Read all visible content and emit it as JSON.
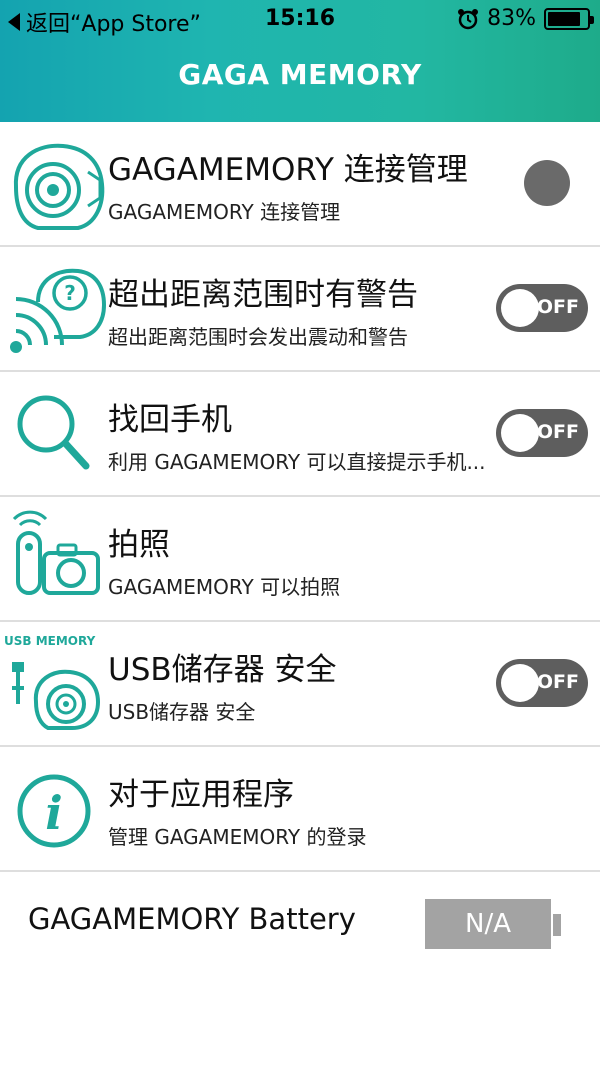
{
  "status_bar": {
    "back_label": "返回“App Store”",
    "time": "15:16",
    "battery_percent_text": "83%",
    "battery_level": 0.83
  },
  "nav": {
    "title": "GAGA MEMORY"
  },
  "rows": [
    {
      "title": "GAGAMEMORY 连接管理",
      "subtitle": "GAGAMEMORY 连接管理",
      "control": "status-dot",
      "icon": "device-icon"
    },
    {
      "title": "超出距离范围时有警告",
      "subtitle": "超出距离范围时会发出震动和警告",
      "control": "toggle",
      "toggle_label": "OFF",
      "icon": "range-warning-icon"
    },
    {
      "title": "找回手机",
      "subtitle": "利用 GAGAMEMORY 可以直接提示手机...",
      "control": "toggle",
      "toggle_label": "OFF",
      "icon": "search-icon"
    },
    {
      "title": "拍照",
      "subtitle": "GAGAMEMORY 可以拍照",
      "control": "none",
      "icon": "camera-icon"
    },
    {
      "title": "USB储存器 安全",
      "subtitle": "USB储存器 安全",
      "control": "toggle",
      "toggle_label": "OFF",
      "icon": "usb-memory-icon",
      "icon_text": "USB MEMORY"
    },
    {
      "title": "对于应用程序",
      "subtitle": "管理 GAGAMEMORY 的登录",
      "control": "none",
      "icon": "info-icon"
    }
  ],
  "battery": {
    "label": "GAGAMEMORY Battery",
    "value": "N/A"
  },
  "colors": {
    "accent": "#1fa89a",
    "header_start": "#14a3b0",
    "header_end": "#1eab8a",
    "toggle_off": "#5e5e5e"
  }
}
